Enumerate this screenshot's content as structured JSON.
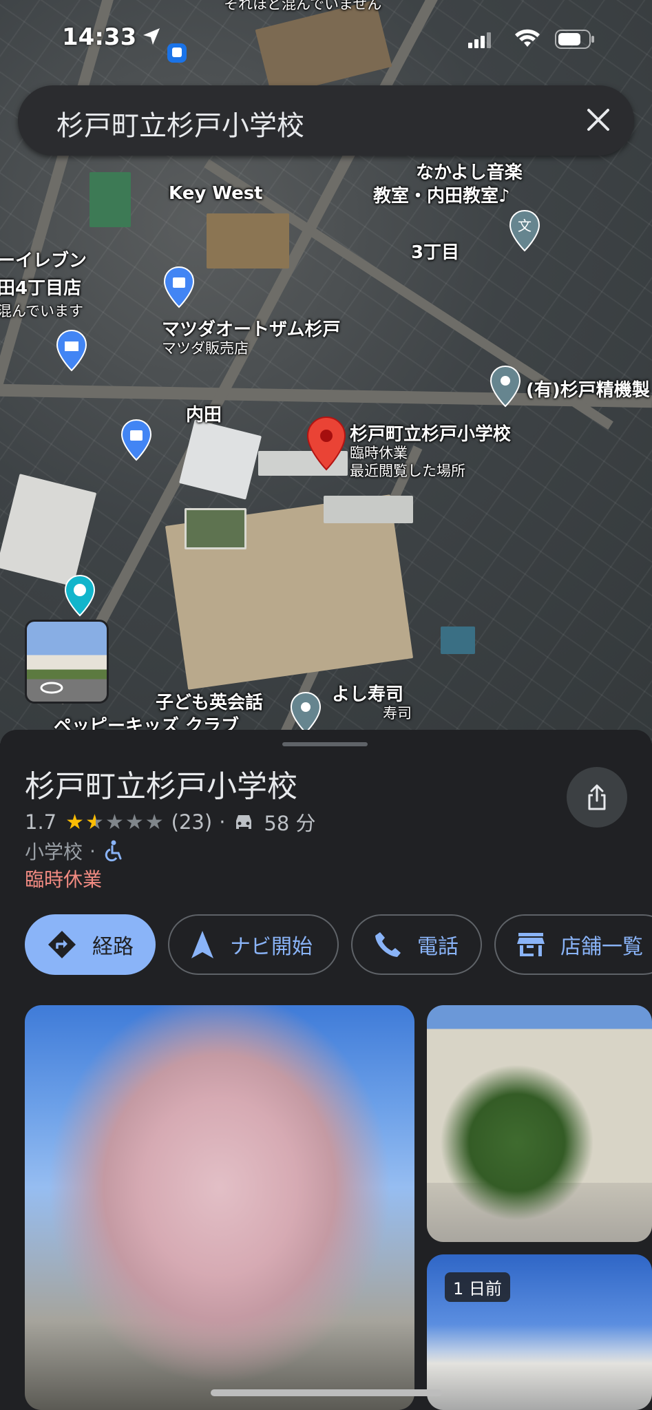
{
  "status_bar": {
    "time": "14:33"
  },
  "search": {
    "query": "杉戸町立杉戸小学校"
  },
  "map": {
    "labels": {
      "top_crowd": "それほど混んでいません",
      "key_west": "Key West",
      "music_school_1": "なかよし音楽",
      "music_school_2": "教室・内田教室♪",
      "chome": "3丁目",
      "seven_1": "ーイレブン",
      "seven_2": "田4丁目店",
      "seven_3": "混んでいます",
      "matsuda_1": "マツダオートザム杉戸",
      "matsuda_2": "マツダ販売店",
      "sugito_seiki": "(有)杉戸精機製",
      "uchida": "内田",
      "school_name": "杉戸町立杉戸小学校",
      "school_status": "臨時休業",
      "school_recent": "最近閲覧した場所",
      "kids_1": "子ども英会話",
      "kids_2": "ペッピーキッズ クラブ",
      "sushi_1": "よし寿司",
      "sushi_2": "寿司"
    }
  },
  "place": {
    "title": "杉戸町立杉戸小学校",
    "rating": "1.7",
    "stars": 1.7,
    "reviews": "(23)",
    "drive_time": "58 分",
    "category": "小学校",
    "status": "臨時休業"
  },
  "actions": {
    "directions": "経路",
    "start": "ナビ開始",
    "call": "電話",
    "stores": "店舗一覧"
  },
  "photos": {
    "badge": "1 日前"
  },
  "colors": {
    "accent_blue": "#8ab4f8",
    "closed_red": "#f28b82",
    "star": "#fbbc04",
    "pin_red": "#ea4335",
    "sheet_bg": "#202124"
  }
}
